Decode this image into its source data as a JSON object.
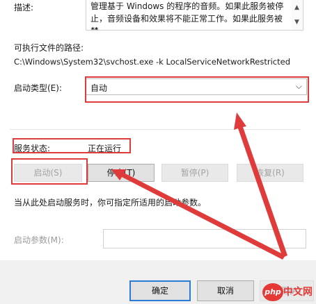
{
  "description": {
    "label": "描述:",
    "text_line1": "管理基于 Windows 的程序的音频。如果此服务被停",
    "text_line2": "止，音频设备和效果将不能正常工作。如果此服务被禁"
  },
  "executable": {
    "label": "可执行文件的路径:",
    "path": "C:\\Windows\\System32\\svchost.exe -k LocalServiceNetworkRestricted"
  },
  "startup_type": {
    "label": "启动类型(E):",
    "selected": "自动"
  },
  "service_status": {
    "label": "服务状态:",
    "value": "正在运行"
  },
  "buttons": {
    "start": "启动(S)",
    "stop": "停止(T)",
    "pause": "暂停(P)",
    "resume": "恢复(R)"
  },
  "hint": "当从此处启动服务时，你可指定所适用的启动参数。",
  "start_params": {
    "label": "启动参数(M):",
    "value": ""
  },
  "footer": {
    "ok": "确定",
    "cancel": "取消",
    "apply": "应用(A)"
  },
  "watermark": {
    "logo_text": "php",
    "site_text": "中文网"
  },
  "colors": {
    "annotation_red": "#e03b3b",
    "primary_blue": "#2b7bd4"
  }
}
